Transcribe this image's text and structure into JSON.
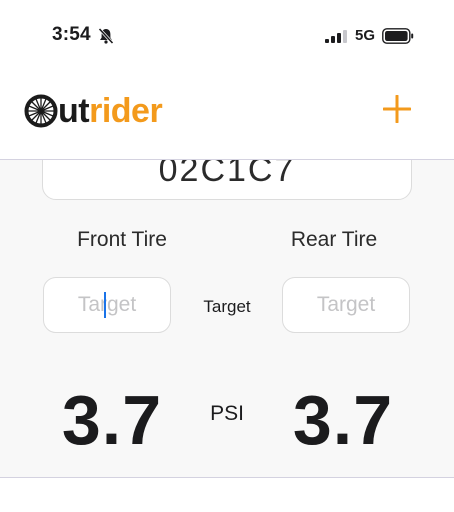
{
  "status_bar": {
    "time": "3:54",
    "network": "5G"
  },
  "header": {
    "logo_dark_part": "ut",
    "logo_orange_part": "rider",
    "brand_color": "#f39a1c",
    "add_icon": "plus-icon"
  },
  "main": {
    "top_field_value": "02C1C7",
    "front_tire": {
      "label": "Front Tire",
      "target_value": "",
      "target_placeholder": "Target",
      "pressure": "3.7"
    },
    "rear_tire": {
      "label": "Rear Tire",
      "target_value": "",
      "target_placeholder": "Target",
      "pressure": "3.7"
    },
    "target_label": "Target",
    "unit": "PSI"
  }
}
